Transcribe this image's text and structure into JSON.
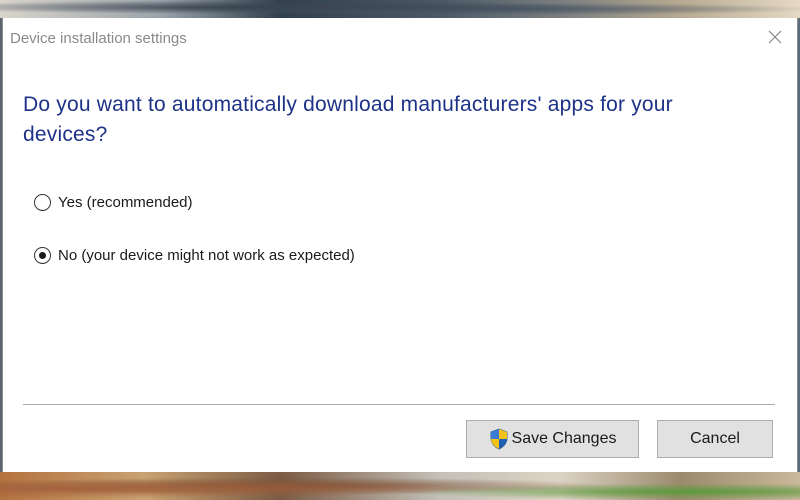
{
  "window": {
    "title": "Device installation settings",
    "close_icon": "close-icon"
  },
  "question": "Do you want to automatically download manufacturers' apps for your devices?",
  "options": [
    {
      "label": "Yes (recommended)",
      "selected": false
    },
    {
      "label": "No (your device might not work as expected)",
      "selected": true
    }
  ],
  "buttons": {
    "save_label": "Save Changes",
    "save_icon": "uac-shield-icon",
    "cancel_label": "Cancel"
  },
  "colors": {
    "question_text": "#1e3287",
    "title_text": "#8a8a8a",
    "button_bg": "#e1e1e1",
    "shield_blue": "#1f5fb4",
    "shield_yellow": "#f2c21b"
  }
}
